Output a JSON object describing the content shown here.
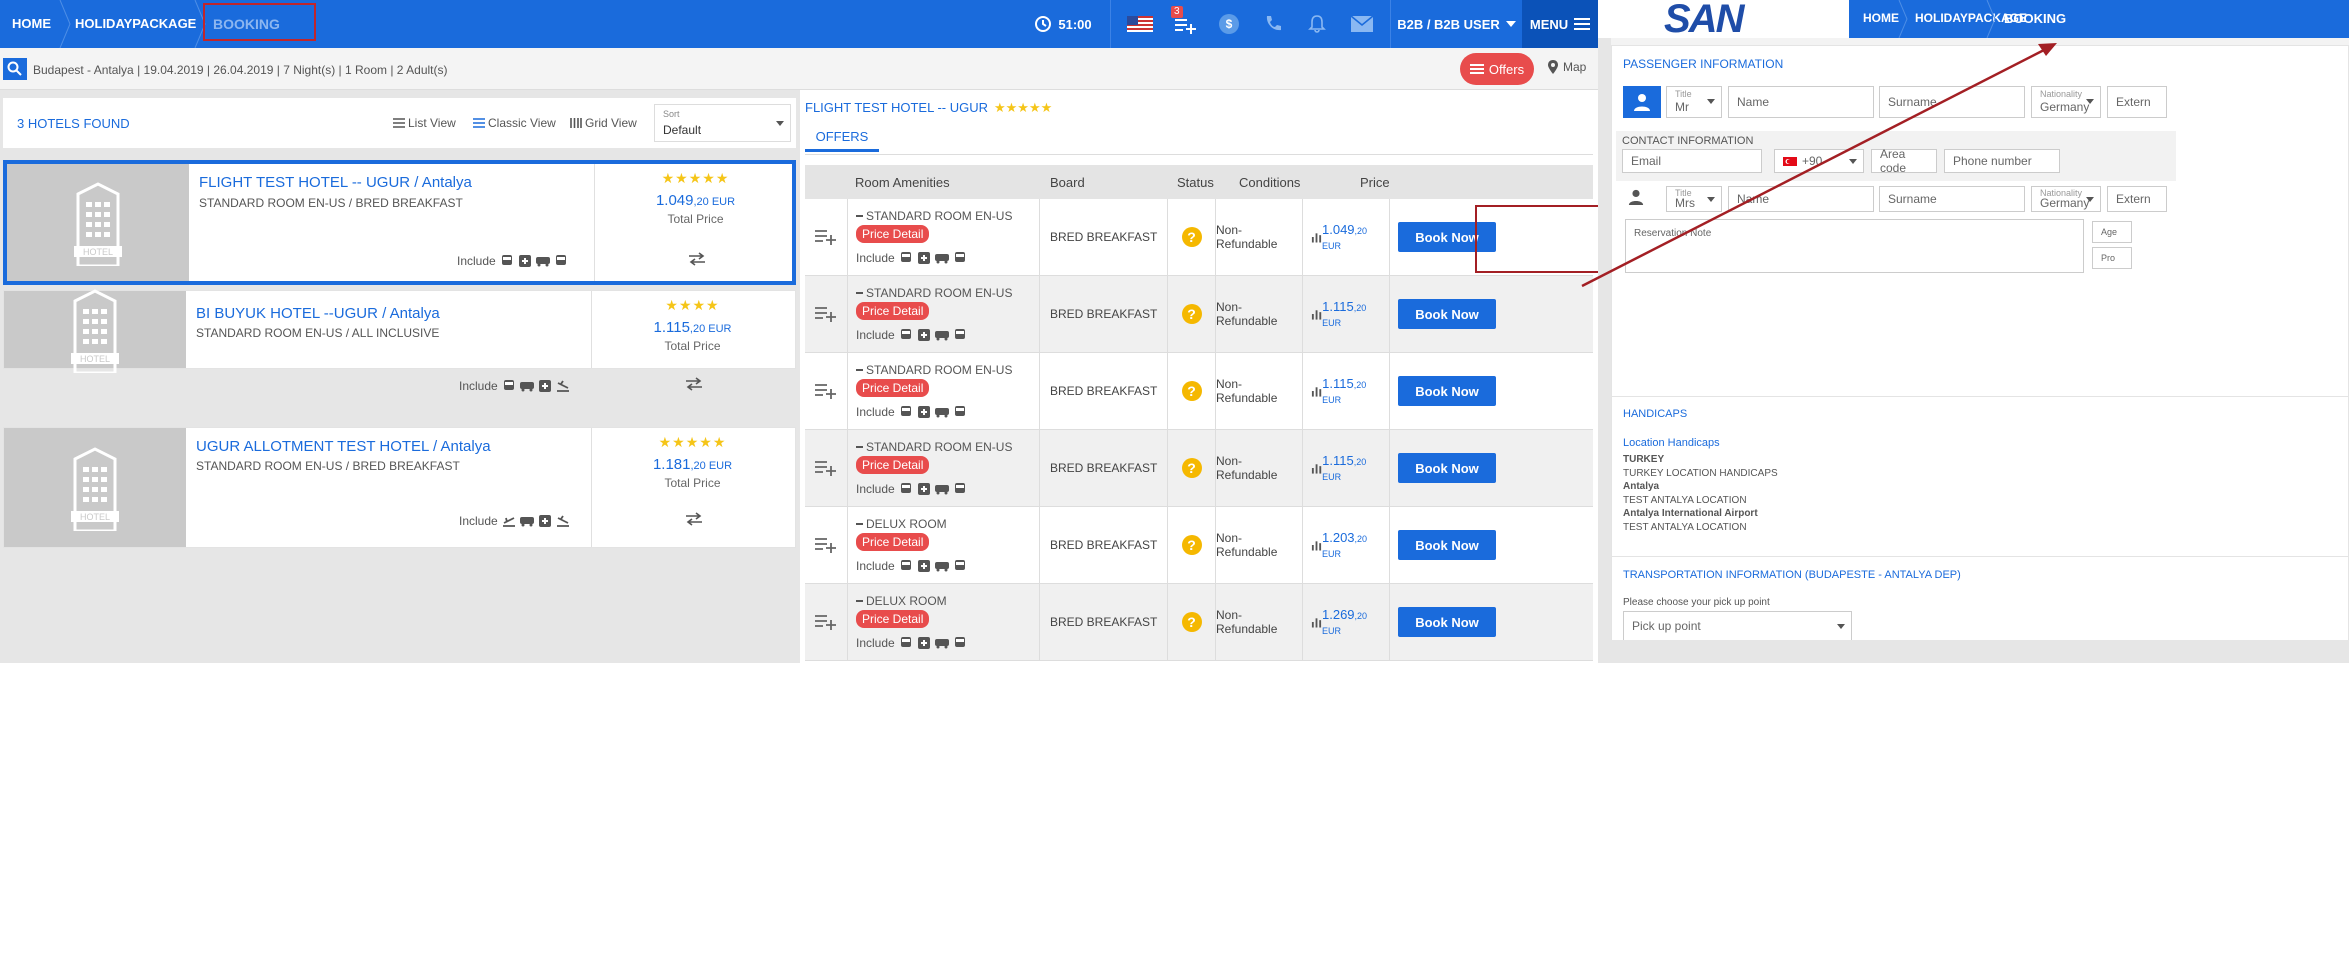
{
  "breadcrumb": {
    "home": "HOME",
    "holiday": "HOLIDAYPACKAGE",
    "booking": "BOOKING"
  },
  "topbar": {
    "timer": "51:00",
    "cart_badge": "3",
    "user": "B2B / B2B USER",
    "menu": "MENU"
  },
  "search_summary": "Budapest - Antalya | 19.04.2019 | 26.04.2019 | 7 Night(s) | 1 Room | 2 Adult(s)",
  "offers_button": "Offers",
  "map_label": "Map",
  "hotels_found": "3 HOTELS FOUND",
  "views": {
    "list": "List View",
    "classic": "Classic View",
    "grid": "Grid View"
  },
  "sort": {
    "label": "Sort",
    "value": "Default"
  },
  "hotel_img_label": "HOTEL",
  "include_label": "Include",
  "hotels": [
    {
      "name": "FLIGHT TEST HOTEL -- UGUR / Antalya",
      "room": "STANDARD ROOM EN-US / BRED BREAKFAST",
      "stars": "★★★★★",
      "price": "1.049",
      "price_dec": ",20 EUR",
      "total": "Total Price"
    },
    {
      "name": "BI BUYUK HOTEL --UGUR / Antalya",
      "room": "STANDARD ROOM EN-US / ALL INCLUSIVE",
      "stars": "★★★★",
      "price": "1.115",
      "price_dec": ",20 EUR",
      "total": "Total Price"
    },
    {
      "name": "UGUR ALLOTMENT TEST HOTEL / Antalya",
      "room": "STANDARD ROOM EN-US / BRED BREAKFAST",
      "stars": "★★★★★",
      "price": "1.181",
      "price_dec": ",20 EUR",
      "total": "Total Price"
    }
  ],
  "offers_panel": {
    "hotel_title": "FLIGHT TEST HOTEL -- UGUR",
    "hotel_stars": "★★★★★",
    "tab": "OFFERS",
    "columns": {
      "amenities": "Room Amenities",
      "board": "Board",
      "status": "Status",
      "conditions": "Conditions",
      "price": "Price"
    },
    "price_detail": "Price Detail",
    "book_now": "Book Now",
    "rows": [
      {
        "room": "STANDARD ROOM EN-US",
        "board": "BRED BREAKFAST",
        "cond": "Non-Refundable",
        "price": "1.049",
        "dec": ",20 EUR"
      },
      {
        "room": "STANDARD ROOM EN-US",
        "board": "BRED BREAKFAST",
        "cond": "Non-Refundable",
        "price": "1.115",
        "dec": ",20 EUR"
      },
      {
        "room": "STANDARD ROOM EN-US",
        "board": "BRED BREAKFAST",
        "cond": "Non-Refundable",
        "price": "1.115",
        "dec": ",20 EUR"
      },
      {
        "room": "STANDARD ROOM EN-US",
        "board": "BRED BREAKFAST",
        "cond": "Non-Refundable",
        "price": "1.115",
        "dec": ",20 EUR"
      },
      {
        "room": "DELUX ROOM",
        "board": "BRED BREAKFAST",
        "cond": "Non-Refundable",
        "price": "1.203",
        "dec": ",20 EUR"
      },
      {
        "room": "DELUX ROOM",
        "board": "BRED BREAKFAST",
        "cond": "Non-Refundable",
        "price": "1.269",
        "dec": ",20 EUR"
      }
    ]
  },
  "right": {
    "logo": "SAN",
    "breadcrumb": {
      "home": "HOME",
      "holiday": "HOLIDAYPACKAGE",
      "booking": "BOOKING"
    },
    "passenger_title": "PASSENGER INFORMATION",
    "title_label": "Title",
    "title_mr": "Mr",
    "title_mrs": "Mrs",
    "name_ph": "Name",
    "surname_ph": "Surname",
    "nationality_label": "Nationality",
    "nationality": "Germany",
    "extern": "Extern",
    "contact_title": "CONTACT INFORMATION",
    "email_ph": "Email",
    "phone_code": "+90",
    "area_ph": "Area code",
    "phone_ph": "Phone number",
    "note_ph": "Reservation Note",
    "age": "Age",
    "pro": "Pro",
    "handicaps_title": "HANDICAPS",
    "location_handicaps": "Location Handicaps",
    "handicaps": [
      "TURKEY",
      "TURKEY LOCATION HANDICAPS",
      "Antalya",
      "TEST ANTALYA LOCATION",
      "Antalya International Airport",
      "TEST ANTALYA LOCATION"
    ],
    "transport_title": "TRANSPORTATION INFORMATION (BUDAPESTE - ANTALYA DEP)",
    "pickup_label": "Please choose your pick up point",
    "pickup_value": "Pick up point"
  },
  "colors": {
    "primary": "#1a6bdc",
    "danger": "#e84c4c",
    "star": "#f5c518",
    "annotation": "#a31f24"
  }
}
